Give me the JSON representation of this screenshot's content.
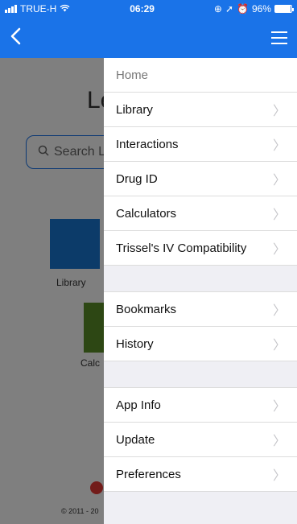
{
  "statusbar": {
    "carrier": "TRUE-H",
    "time": "06:29",
    "battery": "96%",
    "battery_level": 0.96
  },
  "background": {
    "title_fragment": "Le",
    "search_placeholder": "Search L",
    "tile_library_label": "Library",
    "tile_calc_label": "Calc",
    "footer": "© 2011 - 20"
  },
  "menu": {
    "home": "Home",
    "group1": [
      "Library",
      "Interactions",
      "Drug ID",
      "Calculators",
      "Trissel's IV Compatibility"
    ],
    "group2": [
      "Bookmarks",
      "History"
    ],
    "group3": [
      "App Info",
      "Update",
      "Preferences"
    ]
  },
  "icons": {
    "back": "chevron-left-icon",
    "menu": "hamburger-icon",
    "chevron": "chevron-right-icon"
  },
  "colors": {
    "accent": "#1a73e8",
    "library_tile": "#1976d2",
    "calc_tile": "#5a8f29"
  }
}
